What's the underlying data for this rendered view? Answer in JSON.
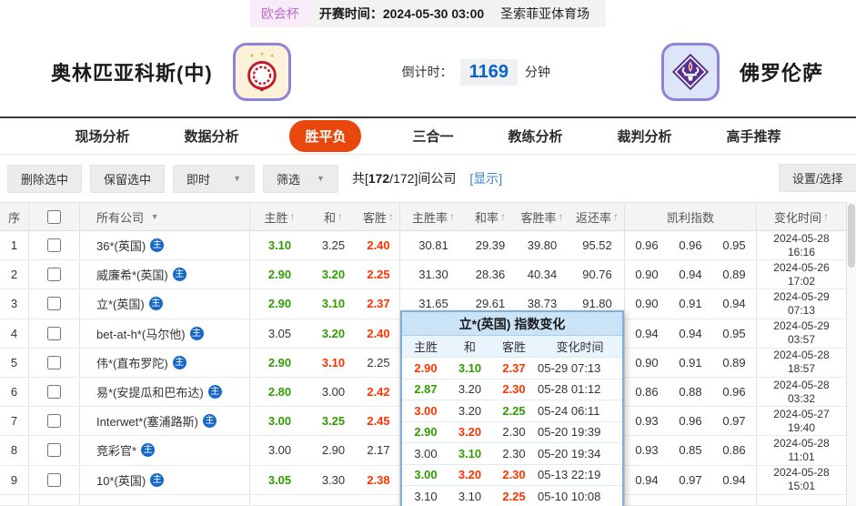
{
  "topbar": {
    "league": "欧会杯",
    "kickoff": "开赛时间：2024-05-30 03:00",
    "venue": "圣索菲亚体育场"
  },
  "match": {
    "home": "奥林匹亚科斯(中)",
    "away": "佛罗伦萨",
    "countdown_label": "倒计时：",
    "countdown": "1169",
    "unit": "分钟"
  },
  "nav": {
    "tabs": [
      "现场分析",
      "数据分析",
      "胜平负",
      "三合一",
      "教练分析",
      "裁判分析",
      "高手推荐"
    ],
    "active_index": 2
  },
  "toolbar": {
    "delete": "删除选中",
    "keep": "保留选中",
    "instant": "即时",
    "filter": "筛选",
    "count_pre": "共[",
    "count_bold": "172",
    "count_post": "/172]间公司",
    "show": "[显示]",
    "settings": "设置/选择"
  },
  "icons": {
    "sort_asc": "↑",
    "dropdown": "▼"
  },
  "table": {
    "headers": {
      "no": "序",
      "company": "所有公司",
      "home": "主胜",
      "draw": "和",
      "away": "客胜",
      "home_rate": "主胜率",
      "draw_rate": "和率",
      "away_rate": "客胜率",
      "return_rate": "返还率",
      "kelly": "凯利指数",
      "time": "变化时间"
    },
    "main_badge": "主",
    "rows": [
      {
        "no": "1",
        "company": "36*(英国)",
        "odds": [
          [
            "3.10",
            "g"
          ],
          [
            "3.25",
            ""
          ],
          [
            "2.40",
            "r"
          ]
        ],
        "rates": [
          "30.81",
          "29.39",
          "39.80",
          "95.52"
        ],
        "kelly": [
          "0.96",
          "0.96",
          "0.95"
        ],
        "date": "2024-05-28",
        "time": "16:16"
      },
      {
        "no": "2",
        "company": "威廉希*(英国)",
        "odds": [
          [
            "2.90",
            "g"
          ],
          [
            "3.20",
            "g"
          ],
          [
            "2.25",
            "r"
          ]
        ],
        "rates": [
          "31.30",
          "28.36",
          "40.34",
          "90.76"
        ],
        "kelly": [
          "0.90",
          "0.94",
          "0.89"
        ],
        "date": "2024-05-26",
        "time": "17:02"
      },
      {
        "no": "3",
        "company": "立*(英国)",
        "odds": [
          [
            "2.90",
            "g"
          ],
          [
            "3.10",
            "g"
          ],
          [
            "2.37",
            "r"
          ]
        ],
        "rates": [
          "31.65",
          "29.61",
          "38.73",
          "91.80"
        ],
        "kelly": [
          "0.90",
          "0.91",
          "0.94"
        ],
        "date": "2024-05-29",
        "time": "07:13"
      },
      {
        "no": "4",
        "company": "bet-at-h*(马尔他)",
        "odds": [
          [
            "3.05",
            ""
          ],
          [
            "3.20",
            "g"
          ],
          [
            "2.40",
            "r"
          ]
        ],
        "rates": [
          "",
          "",
          "",
          ""
        ],
        "kelly": [
          "0.94",
          "0.94",
          "0.95"
        ],
        "date": "2024-05-29",
        "time": "03:57"
      },
      {
        "no": "5",
        "company": "伟*(直布罗陀)",
        "odds": [
          [
            "2.90",
            "g"
          ],
          [
            "3.10",
            "r"
          ],
          [
            "2.25",
            ""
          ]
        ],
        "rates": [
          "",
          "",
          "",
          ""
        ],
        "kelly": [
          "0.90",
          "0.91",
          "0.89"
        ],
        "date": "2024-05-28",
        "time": "18:57"
      },
      {
        "no": "6",
        "company": "易*(安提瓜和巴布达)",
        "odds": [
          [
            "2.80",
            "g"
          ],
          [
            "3.00",
            ""
          ],
          [
            "2.42",
            "r"
          ]
        ],
        "rates": [
          "",
          "",
          "",
          ""
        ],
        "kelly": [
          "0.86",
          "0.88",
          "0.96"
        ],
        "date": "2024-05-28",
        "time": "03:32"
      },
      {
        "no": "7",
        "company": "Interwet*(塞浦路斯)",
        "odds": [
          [
            "3.00",
            "g"
          ],
          [
            "3.25",
            "g"
          ],
          [
            "2.45",
            "r"
          ]
        ],
        "rates": [
          "",
          "",
          "",
          ""
        ],
        "kelly": [
          "0.93",
          "0.96",
          "0.97"
        ],
        "date": "2024-05-27",
        "time": "19:40"
      },
      {
        "no": "8",
        "company": "竞彩官*",
        "odds": [
          [
            "3.00",
            ""
          ],
          [
            "2.90",
            ""
          ],
          [
            "2.17",
            ""
          ]
        ],
        "rates": [
          "",
          "",
          "",
          ""
        ],
        "kelly": [
          "0.93",
          "0.85",
          "0.86"
        ],
        "date": "2024-05-28",
        "time": "11:01"
      },
      {
        "no": "9",
        "company": "10*(英国)",
        "odds": [
          [
            "3.05",
            "g"
          ],
          [
            "3.30",
            ""
          ],
          [
            "2.38",
            "r"
          ]
        ],
        "rates": [
          "",
          "",
          "",
          ""
        ],
        "kelly": [
          "0.94",
          "0.97",
          "0.94"
        ],
        "date": "2024-05-28",
        "time": "15:01"
      }
    ]
  },
  "popup": {
    "title": "立*(英国) 指数变化",
    "headers": [
      "主胜",
      "和",
      "客胜",
      "变化时间"
    ],
    "rows": [
      {
        "vals": [
          [
            "2.90",
            "r"
          ],
          [
            "3.10",
            "g"
          ],
          [
            "2.37",
            "r"
          ]
        ],
        "time": "05-29 07:13"
      },
      {
        "vals": [
          [
            "2.87",
            "g"
          ],
          [
            "3.20",
            ""
          ],
          [
            "2.30",
            "r"
          ]
        ],
        "time": "05-28 01:12"
      },
      {
        "vals": [
          [
            "3.00",
            "r"
          ],
          [
            "3.20",
            ""
          ],
          [
            "2.25",
            "g"
          ]
        ],
        "time": "05-24 06:11"
      },
      {
        "vals": [
          [
            "2.90",
            "g"
          ],
          [
            "3.20",
            "r"
          ],
          [
            "2.30",
            ""
          ]
        ],
        "time": "05-20 19:39"
      },
      {
        "vals": [
          [
            "3.00",
            ""
          ],
          [
            "3.10",
            "g"
          ],
          [
            "2.30",
            ""
          ]
        ],
        "time": "05-20 19:34"
      },
      {
        "vals": [
          [
            "3.00",
            "g"
          ],
          [
            "3.20",
            "r"
          ],
          [
            "2.30",
            "r"
          ]
        ],
        "time": "05-13 22:19"
      },
      {
        "vals": [
          [
            "3.10",
            ""
          ],
          [
            "3.10",
            ""
          ],
          [
            "2.25",
            "r"
          ]
        ],
        "time": "05-10 10:08"
      }
    ]
  }
}
